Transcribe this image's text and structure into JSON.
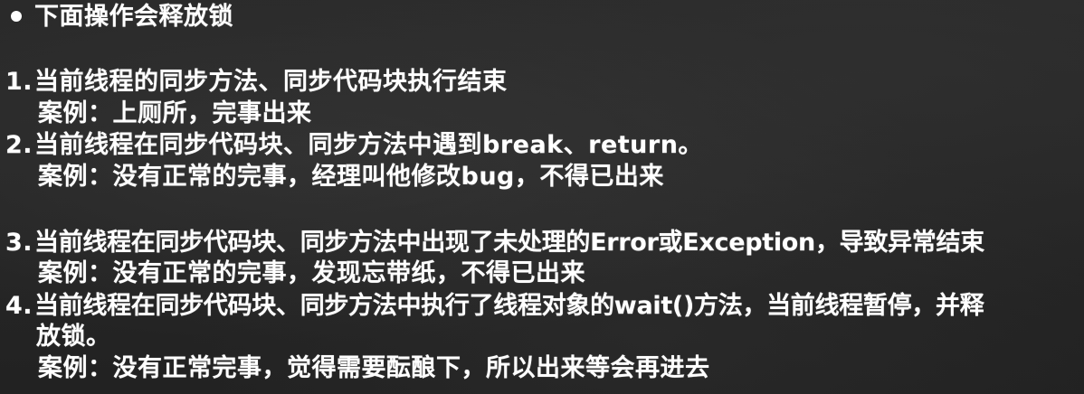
{
  "heading": {
    "text": "下面操作会释放锁"
  },
  "items": [
    {
      "number": "1.",
      "text": "当前线程的同步方法、同步代码块执行结束",
      "example": "案例：上厕所，完事出来"
    },
    {
      "number": "2.",
      "text": "当前线程在同步代码块、同步方法中遇到break、return。",
      "example": "案例：没有正常的完事，经理叫他修改bug，不得已出来"
    },
    {
      "number": "3.",
      "text": "当前线程在同步代码块、同步方法中出现了未处理的Error或Exception，导致异常结束",
      "example": "案例：没有正常的完事，发现忘带纸，不得已出来"
    },
    {
      "number": "4.",
      "text": "当前线程在同步代码块、同步方法中执行了线程对象的wait()方法，当前线程暂停，并释",
      "text_cont": "放锁。",
      "example": "案例：没有正常完事，觉得需要酝酿下，所以出来等会再进去"
    }
  ]
}
